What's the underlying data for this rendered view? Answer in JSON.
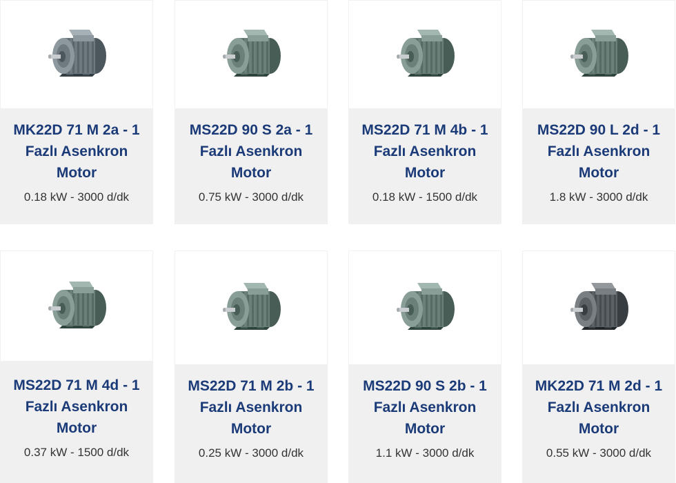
{
  "products": [
    {
      "title": "MK22D 71 M 2a - 1 Fazlı Asenkron Motor",
      "spec": "0.18 kW - 3000 d/dk",
      "image": "motor-image",
      "color": "#6f7980"
    },
    {
      "title": "MS22D 90 S 2a - 1 Fazlı Asenkron Motor",
      "spec": "0.75 kW - 3000 d/dk",
      "image": "motor-image",
      "color": "#6a8079"
    },
    {
      "title": "MS22D 71 M 4b - 1 Fazlı Asenkron Motor",
      "spec": "0.18 kW - 1500 d/dk",
      "image": "motor-image",
      "color": "#6a8079"
    },
    {
      "title": "MS22D 90 L 2d - 1 Fazlı Asenkron Motor",
      "spec": "1.8 kW - 3000 d/dk",
      "image": "motor-image",
      "color": "#6a8079"
    },
    {
      "title": "MS22D 71 M 4d - 1 Fazlı Asenkron Motor",
      "spec": "0.37 kW - 1500 d/dk",
      "image": "motor-image",
      "color": "#6a8079"
    },
    {
      "title": "MS22D 71 M 2b - 1 Fazlı Asenkron Motor",
      "spec": "0.25 kW - 3000 d/dk",
      "image": "motor-image",
      "color": "#6a8079"
    },
    {
      "title": "MS22D 90 S 2b - 1 Fazlı Asenkron Motor",
      "spec": "1.1 kW - 3000 d/dk",
      "image": "motor-image",
      "color": "#6a8079"
    },
    {
      "title": "MK22D 71 M 2d - 1 Fazlı Asenkron Motor",
      "spec": "0.55 kW - 3000 d/dk",
      "image": "motor-image",
      "color": "#5c6166"
    }
  ]
}
